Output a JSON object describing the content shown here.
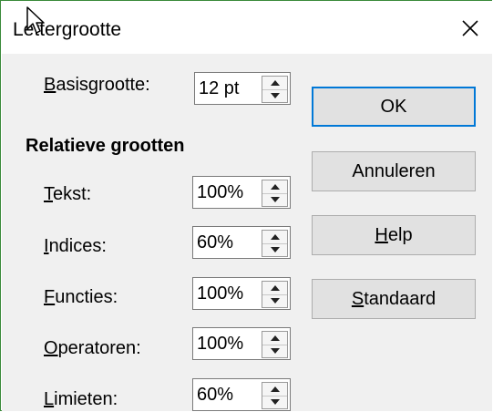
{
  "dialog": {
    "title": "Lettergrootte",
    "close_glyph": "✕"
  },
  "base_size": {
    "label_mnemonic": "B",
    "label_rest": "asisgrootte:",
    "value": "12 pt"
  },
  "relative": {
    "heading": "Relatieve grootten",
    "rows": [
      {
        "mnemonic": "T",
        "rest": "ekst:",
        "value": "100%"
      },
      {
        "mnemonic": "I",
        "rest": "ndices:",
        "value": "60%"
      },
      {
        "mnemonic": "F",
        "rest": "uncties:",
        "value": "100%"
      },
      {
        "mnemonic": "O",
        "rest": "peratoren:",
        "value": "100%"
      },
      {
        "mnemonic": "L",
        "rest": "imieten:",
        "value": "60%"
      }
    ]
  },
  "buttons": {
    "ok": "OK",
    "cancel": "Annuleren",
    "help_mnemonic": "H",
    "help_rest": "elp",
    "default_mnemonic": "S",
    "default_rest": "tandaard"
  },
  "colors": {
    "default_button_border": "#0078d7",
    "dialog_background": "#f0f0f0",
    "window_border": "#3a8a3a"
  }
}
